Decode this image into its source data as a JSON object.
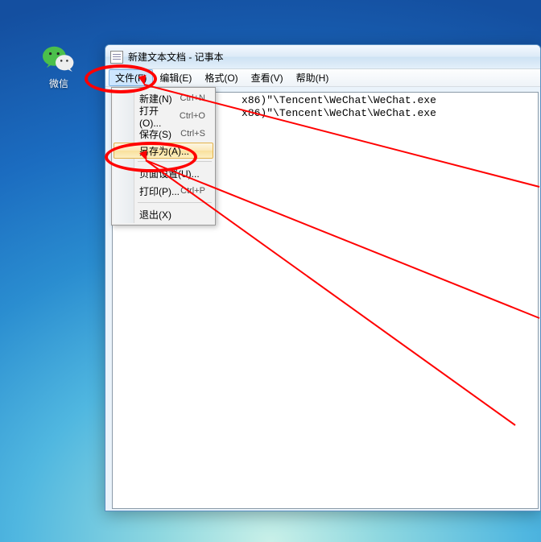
{
  "desktop": {
    "wechat_label": "微信"
  },
  "window": {
    "title": "新建文本文档 - 记事本"
  },
  "menubar": {
    "file": "文件(F)",
    "edit": "编辑(E)",
    "format": "格式(O)",
    "view": "查看(V)",
    "help": "帮助(H)"
  },
  "content": {
    "line_fragment": "x86)\"\\Tencent\\WeChat\\WeChat.exe"
  },
  "file_menu": {
    "new_label": "新建(N)",
    "new_sc": "Ctrl+N",
    "open_label": "打开(O)...",
    "open_sc": "Ctrl+O",
    "save_label": "保存(S)",
    "save_sc": "Ctrl+S",
    "saveas_label": "另存为(A)...",
    "pagesetup_label": "页面设置(U)...",
    "print_label": "打印(P)...",
    "print_sc": "Ctrl+P",
    "exit_label": "退出(X)"
  }
}
